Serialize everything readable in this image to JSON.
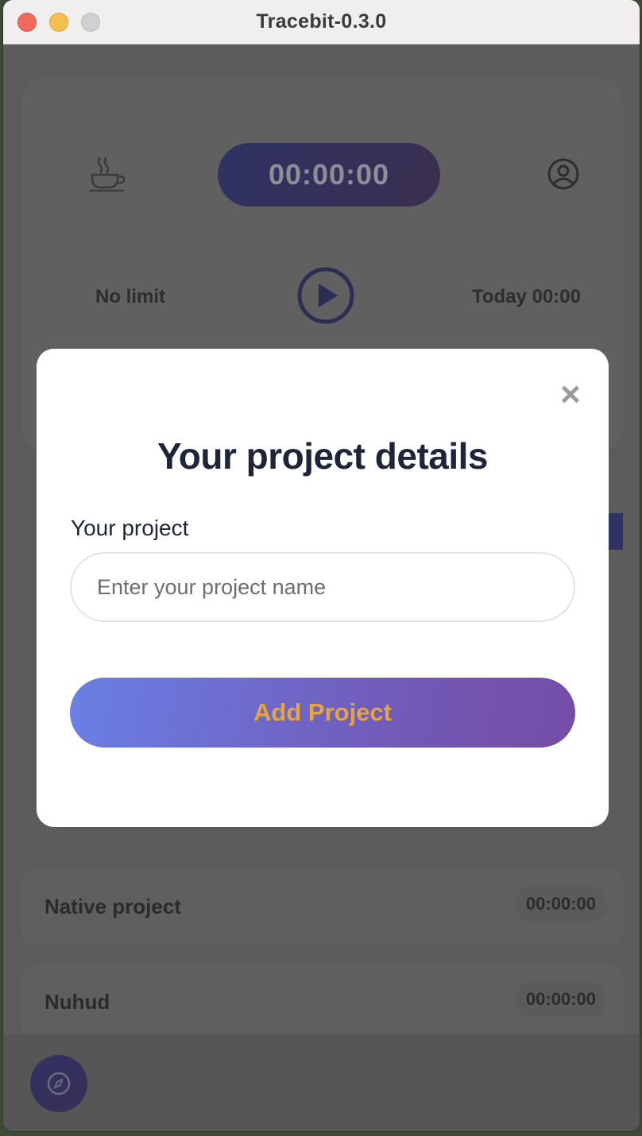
{
  "window": {
    "title": "Tracebit-0.3.0"
  },
  "background": {
    "timer": "00:00:00",
    "limit": "No limit",
    "today": "Today 00:00",
    "projects": [
      {
        "name": "Native project",
        "time": "00:00:00"
      },
      {
        "name": "Nuhud",
        "time": "00:00:00"
      }
    ]
  },
  "modal": {
    "close_symbol": "×",
    "title": "Your project details",
    "field_label": "Your project",
    "input_placeholder": "Enter your project name",
    "input_value": "",
    "submit_label": "Add Project"
  },
  "colors": {
    "accent_gradient_start": "#6a7fe5",
    "accent_gradient_end": "#744da6",
    "button_text": "#e6a53a",
    "title_text": "#1e2538"
  },
  "icons": [
    "coffee-icon",
    "user-circle-icon",
    "play-icon",
    "compass-icon",
    "close-icon"
  ]
}
